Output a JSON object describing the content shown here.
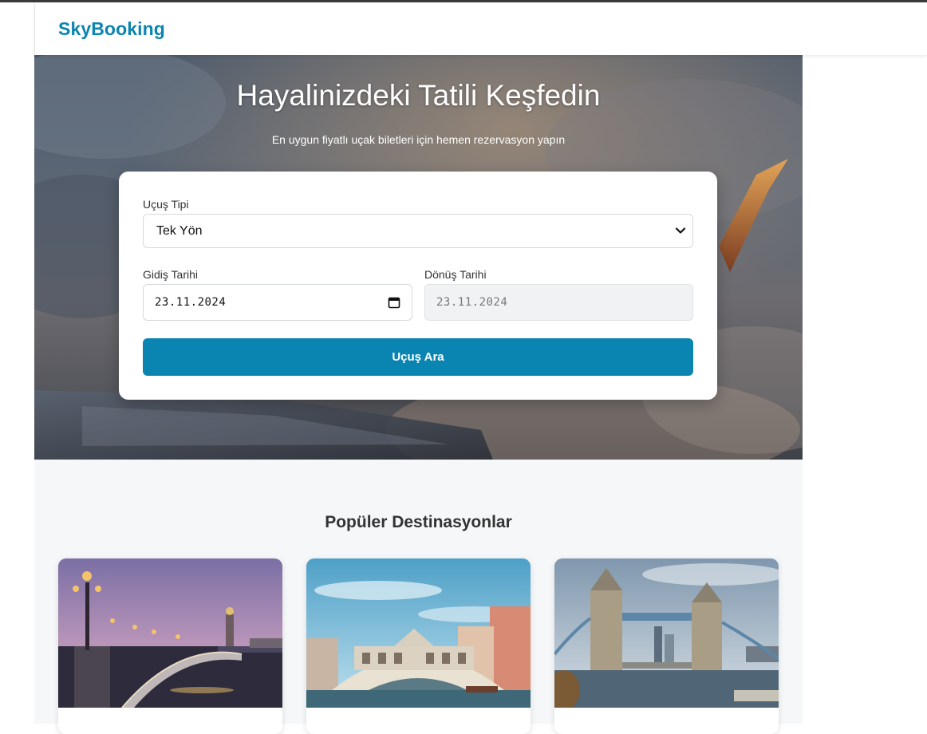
{
  "navbar": {
    "brand": "SkyBooking"
  },
  "hero": {
    "title": "Hayalinizdeki Tatili Keşfedin",
    "subtitle": "En uygun fiyatlı uçak biletleri için hemen rezervasyon yapın"
  },
  "search": {
    "flight_type_label": "Uçuş Tipi",
    "flight_type_value": "Tek Yön",
    "departure_label": "Gidiş Tarihi",
    "departure_value": "23.11.2024",
    "return_label": "Dönüş Tarihi",
    "return_value": "23.11.2024",
    "button_label": "Uçuş Ara"
  },
  "popular": {
    "title": "Popüler Destinasyonlar",
    "cards": [
      {
        "scene": "paris-bridge-dusk"
      },
      {
        "scene": "venice-rialto-bridge"
      },
      {
        "scene": "london-tower-bridge"
      }
    ]
  },
  "colors": {
    "brand": "#0a84b0",
    "section_bg": "#f5f7f9"
  },
  "icons": {
    "select_chevron": "chevron-down-icon",
    "date_picker": "calendar-icon"
  }
}
